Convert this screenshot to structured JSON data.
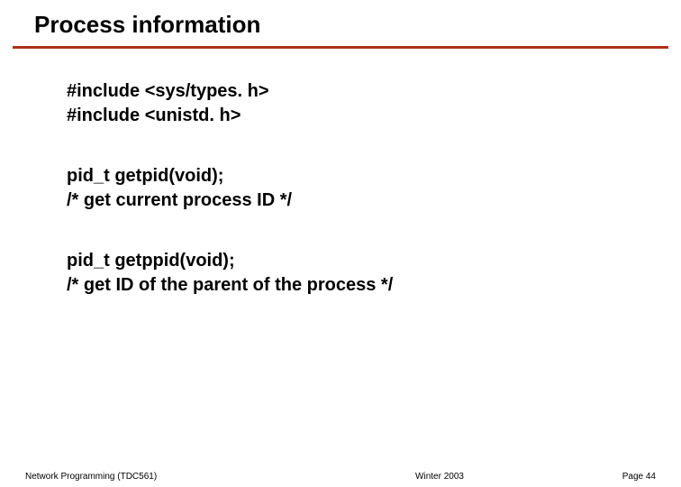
{
  "title": "Process information",
  "blocks": {
    "b0": {
      "l0": "#include <sys/types. h>",
      "l1": "#include <unistd. h>"
    },
    "b1": {
      "l0": "pid_t getpid(void);",
      "l1": "/* get current process ID */"
    },
    "b2": {
      "l0": "pid_t getppid(void);",
      "l1": "/* get ID of the parent of the process */"
    }
  },
  "footer": {
    "left": "Network Programming (TDC561)",
    "center": "Winter   2003",
    "right": "Page 44"
  }
}
